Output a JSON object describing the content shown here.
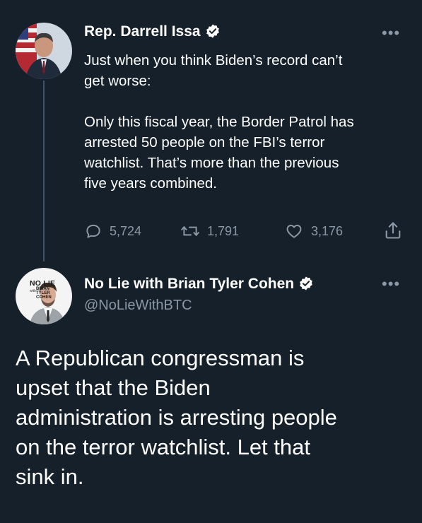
{
  "quoted_tweet": {
    "author_name": "Rep. Darrell Issa",
    "verified": true,
    "more_label": "•••",
    "text": "Just when you think Biden’s record can’t\nget worse:\n\nOnly this fiscal year, the Border Patrol has\narrested 50 people on the FBI’s terror\nwatchlist. That’s more than the previous\nfive years combined.",
    "replies": "5,724",
    "retweets": "1,791",
    "likes": "3,176"
  },
  "reply_tweet": {
    "author_name": "No Lie with Brian Tyler Cohen",
    "handle": "@NoLieWithBTC",
    "verified": true,
    "more_label": "•••",
    "avatar_text": {
      "line1": "NO LIE",
      "with": "with",
      "line2": "BRIAN",
      "line3": "TYLER",
      "line4": "COHEN"
    },
    "text": "A Republican congressman is\nupset that the Biden\nadministration is arresting people\non the terror watchlist. Let that\nsink in."
  },
  "colors": {
    "background": "#15202b",
    "primary_text": "#ffffff",
    "secondary_text": "#8b98a5",
    "thread_line": "#3d5466"
  },
  "icons": [
    "reply-icon",
    "retweet-icon",
    "like-icon",
    "share-icon",
    "verified-badge-icon",
    "more-options-icon"
  ]
}
